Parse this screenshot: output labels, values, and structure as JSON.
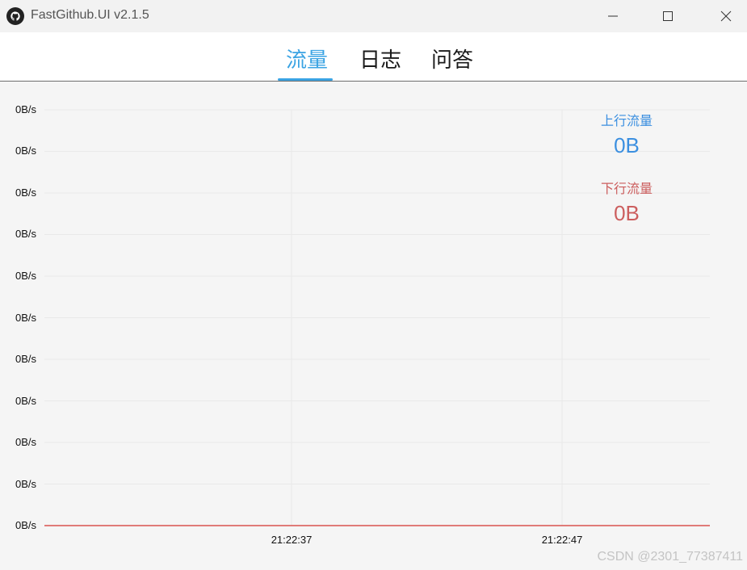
{
  "window": {
    "title": "FastGithub.UI v2.1.5",
    "icon": "github-icon",
    "controls": [
      "minimize-icon",
      "maximize-icon",
      "close-icon"
    ]
  },
  "tabs": [
    {
      "label": "流量",
      "active": true
    },
    {
      "label": "日志",
      "active": false
    },
    {
      "label": "问答",
      "active": false
    }
  ],
  "colors": {
    "accent": "#3aa3e3",
    "upload": "#3b8fe0",
    "download": "#cc5e5e",
    "series_line": "#d9534f"
  },
  "stats": {
    "upload_label": "上行流量",
    "upload_value": "0B",
    "download_label": "下行流量",
    "download_value": "0B"
  },
  "watermark": "CSDN @2301_77387411",
  "chart_data": {
    "type": "line",
    "y_tick_labels": [
      "0B/s",
      "0B/s",
      "0B/s",
      "0B/s",
      "0B/s",
      "0B/s",
      "0B/s",
      "0B/s",
      "0B/s",
      "0B/s",
      "0B/s"
    ],
    "x_tick_labels": [
      "21:22:37",
      "21:22:47"
    ],
    "series": [
      {
        "color": "#d9534f",
        "values": [
          0,
          0
        ]
      }
    ],
    "grid": true
  }
}
